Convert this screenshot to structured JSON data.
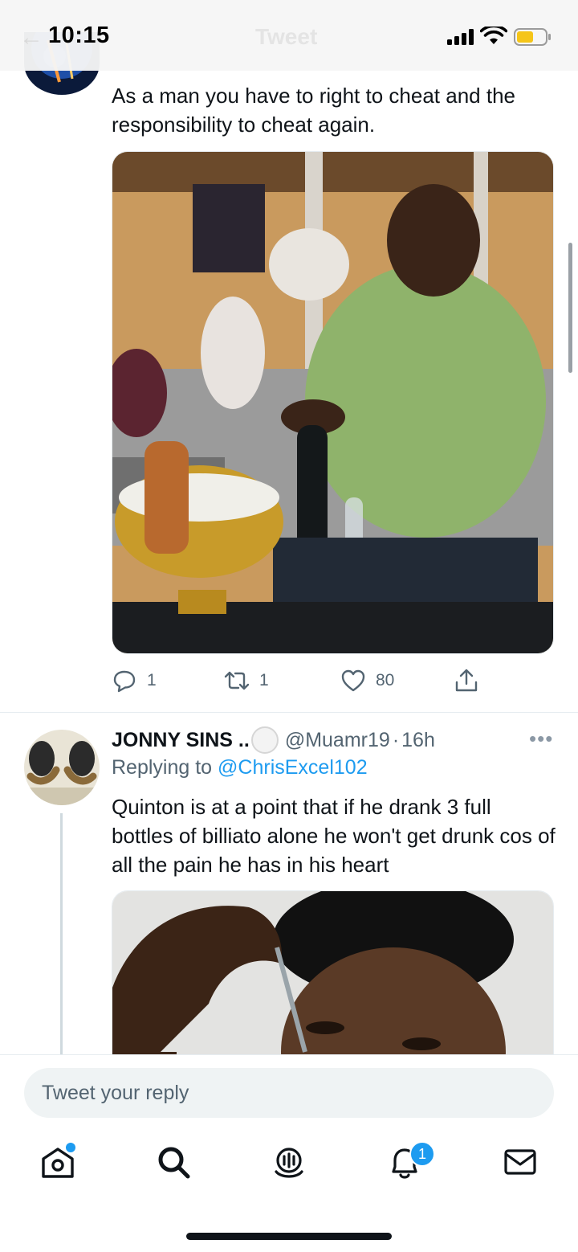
{
  "status_bar": {
    "time": "10:15",
    "faded_back": "←",
    "faded_title": "Tweet",
    "icons": [
      "cellular-signal-icon",
      "wifi-icon",
      "battery-low-icon"
    ],
    "battery_color": "#f5c518"
  },
  "tweet_1": {
    "text": "As a man you have to right to cheat and the responsibility to cheat again.",
    "media_description_icon": "photo",
    "actions": {
      "reply_count": "1",
      "retweet_count": "1",
      "like_count": "80"
    }
  },
  "tweet_2": {
    "display_name": "JONNY SINS ..",
    "handle": "@Muamr19",
    "separator": "·",
    "time": "16h",
    "more": "•••",
    "replying_label": "Replying to",
    "replying_handle": "@ChrisExcel102",
    "text": "Quinton is at a point that if he drank 3 full bottles of billiato alone he won't get drunk cos of all the pain he has in his heart"
  },
  "reply_box": {
    "placeholder": "Tweet your reply"
  },
  "tab_bar": {
    "items": [
      "home-icon",
      "search-icon",
      "spaces-icon",
      "notifications-icon",
      "messages-icon"
    ],
    "notification_badge": "1"
  },
  "colors": {
    "accent": "#1d9bf0",
    "text": "#0f1419",
    "secondary": "#536471"
  }
}
